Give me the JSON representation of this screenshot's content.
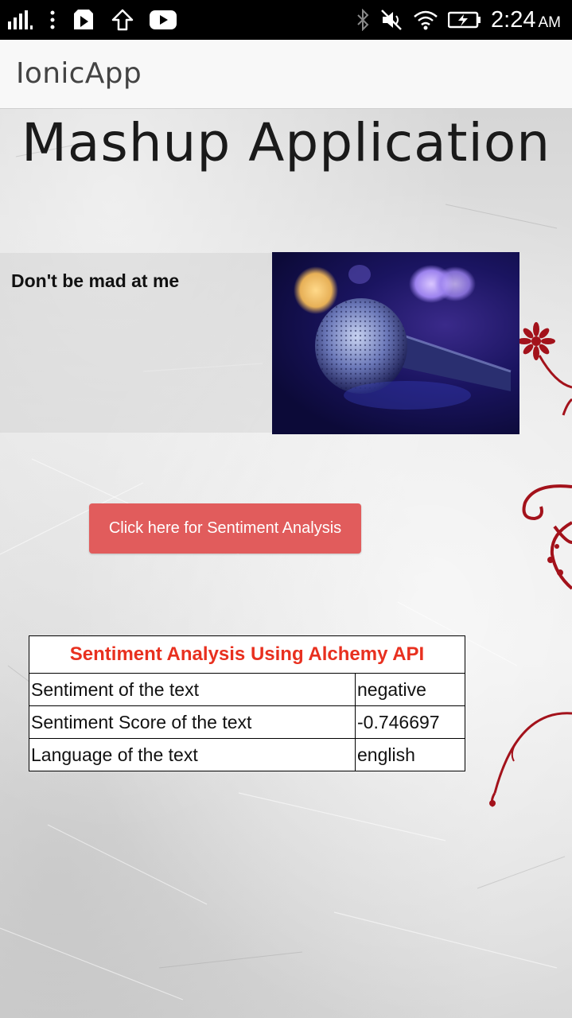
{
  "status_bar": {
    "time": "2:24",
    "ampm": "AM",
    "icons_left": [
      "signal-icon",
      "more-vert-icon",
      "play-store-icon",
      "upload-icon",
      "youtube-icon"
    ],
    "icons_right": [
      "bluetooth-icon",
      "mute-icon",
      "wifi-icon",
      "battery-icon"
    ]
  },
  "app": {
    "title": "IonicApp"
  },
  "page": {
    "title": "Mashup Application",
    "quote": "Don't be mad at me",
    "button_label": "Click here for Sentiment Analysis"
  },
  "results": {
    "caption": "Sentiment Analysis Using Alchemy API",
    "rows": [
      {
        "label": "Sentiment of the text",
        "value": "negative"
      },
      {
        "label": "Sentiment Score of the text",
        "value": "-0.746697"
      },
      {
        "label": "Language of the text",
        "value": "english"
      }
    ]
  },
  "colors": {
    "button": "#e15c5c",
    "caption": "#e8301f",
    "swirl": "#a3121b"
  }
}
